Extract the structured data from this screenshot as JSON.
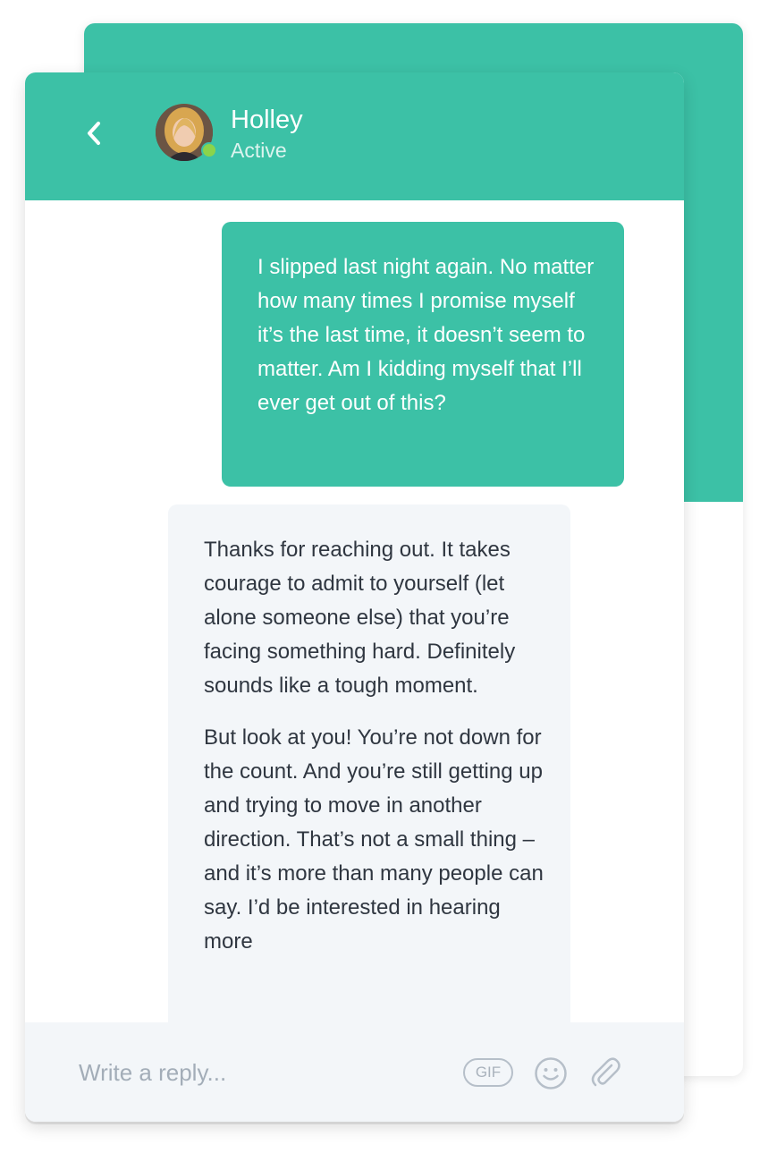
{
  "colors": {
    "accent": "#3cc1a6",
    "received_bubble": "#f3f6f9",
    "presence": "#8bd44b",
    "text_dark": "#2f3640",
    "placeholder": "#a3adb8"
  },
  "header": {
    "back_icon": "chevron-left-icon",
    "contact_name": "Holley",
    "contact_status": "Active"
  },
  "messages": {
    "sent": {
      "text": "I slipped last night again. No matter how many times I promise myself it’s the last time, it doesn’t seem to matter. Am I kidding myself that I’ll ever get out of this?"
    },
    "received": {
      "paragraph_1": "Thanks for reaching out. It takes courage to admit to yourself (let alone someone else) that you’re facing something hard. Definitely sounds like a tough moment.",
      "paragraph_2": "But look at you! You’re not down for the count. And you’re still getting up and trying to move in another direction. That’s not a small thing – and it’s more than many people can say. I’d be interested in hearing more"
    }
  },
  "composer": {
    "placeholder": "Write a reply...",
    "gif_label": "GIF",
    "emoji_icon": "smiley-icon",
    "attach_icon": "paperclip-icon"
  }
}
